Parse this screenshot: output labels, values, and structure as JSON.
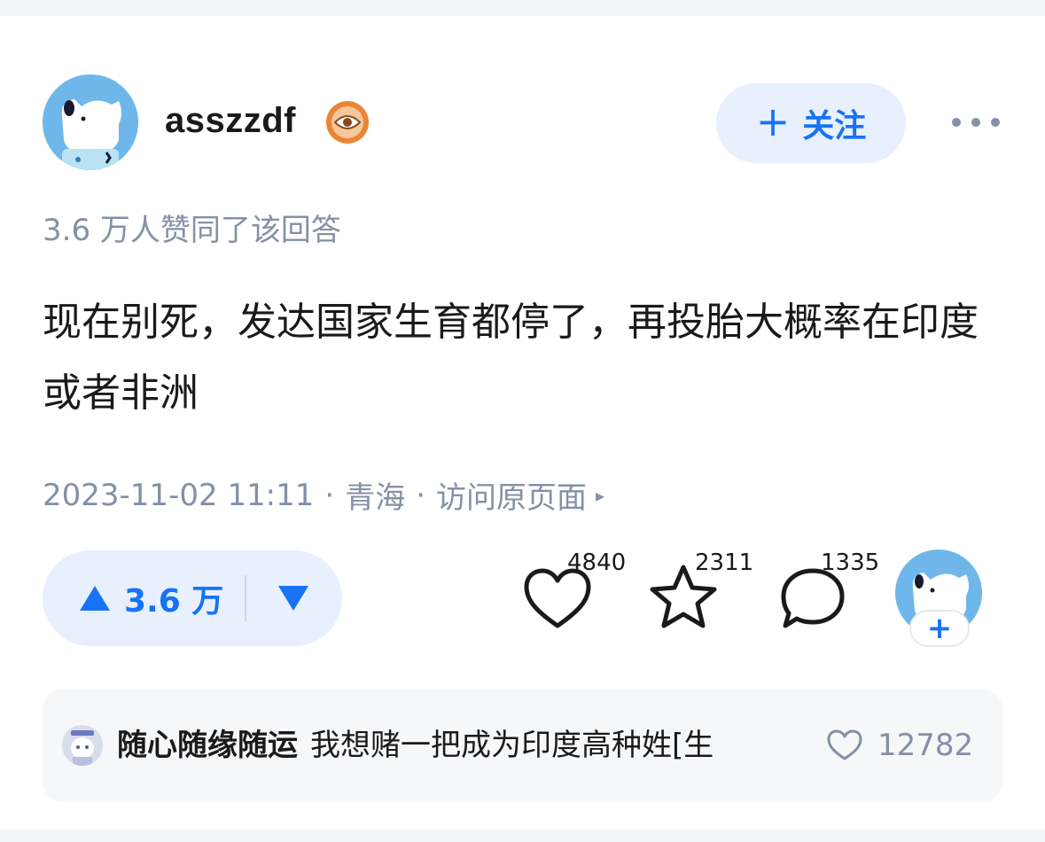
{
  "post": {
    "author": {
      "username": "asszzdf",
      "avatar_icon": "cartoon-dog-avatar",
      "badge_icon": "eye-badge-icon"
    },
    "follow_button": {
      "icon": "plus-icon",
      "label": "关注"
    },
    "more_icon": "more-dots-icon",
    "upvote_summary": "3.6 万人赞同了该回答",
    "answer_text": "现在别死，发达国家生育都停了，再投胎大概率在印度或者非洲",
    "meta": {
      "datetime": "2023-11-02 11:11",
      "separator": "·",
      "location": "青海",
      "link_label": "访问原页面",
      "link_arrow": "▸"
    }
  },
  "actions": {
    "vote": {
      "upvote_label": "3.6 万",
      "upvote_icon": "triangle-up-icon",
      "downvote_icon": "triangle-down-icon"
    },
    "like": {
      "icon": "heart-icon",
      "count": "4840"
    },
    "favorite": {
      "icon": "star-icon",
      "count": "2311"
    },
    "comment": {
      "icon": "comment-bubble-icon",
      "count": "1335"
    },
    "author_follow": {
      "icon": "plus-icon",
      "label": "+"
    }
  },
  "top_comment": {
    "username": "随心随缘随运",
    "text": "我想赌一把成为印度高种姓[生",
    "like_count": "12782",
    "like_icon": "heart-icon"
  },
  "colors": {
    "accent": "#1772f6",
    "accent_bg": "#e8f0fd",
    "muted": "#8590a6",
    "text": "#1a1a1a",
    "comment_bg": "#f6f7f9"
  }
}
